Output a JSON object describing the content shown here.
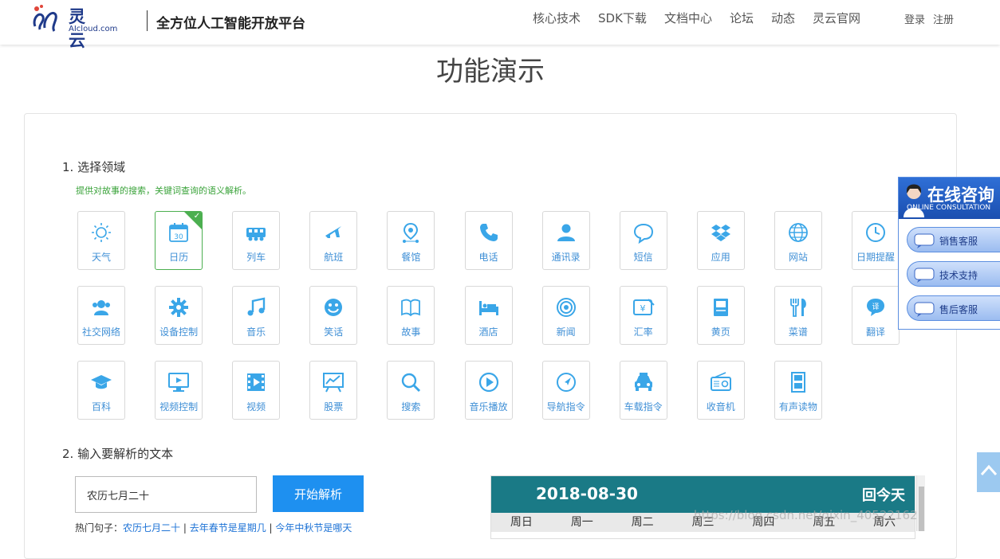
{
  "header": {
    "logo_name": "灵云",
    "logo_domain": "AIcloud.com",
    "slogan": "全方位人工智能开放平台",
    "nav": [
      "核心技术",
      "SDK下载",
      "文档中心",
      "论坛",
      "动态",
      "灵云官网"
    ],
    "login": "登录",
    "register": "注册"
  },
  "page_title": "功能演示",
  "step1": {
    "title": "1. 选择领域",
    "hint": "提供对故事的搜索，关键词查询的语义解析。"
  },
  "domains": [
    {
      "label": "天气",
      "icon": "sun-icon"
    },
    {
      "label": "日历",
      "icon": "calendar-icon",
      "selected": true
    },
    {
      "label": "列车",
      "icon": "train-icon"
    },
    {
      "label": "航班",
      "icon": "airplane-icon"
    },
    {
      "label": "餐馆",
      "icon": "map-pin-icon"
    },
    {
      "label": "电话",
      "icon": "phone-icon"
    },
    {
      "label": "通讯录",
      "icon": "contact-icon"
    },
    {
      "label": "短信",
      "icon": "message-icon"
    },
    {
      "label": "应用",
      "icon": "app-box-icon"
    },
    {
      "label": "网站",
      "icon": "globe-icon"
    },
    {
      "label": "日期提醒",
      "icon": "clock-icon"
    },
    {
      "label": "社交网络",
      "icon": "users-icon"
    },
    {
      "label": "设备控制",
      "icon": "gear-icon"
    },
    {
      "label": "音乐",
      "icon": "music-icon"
    },
    {
      "label": "笑话",
      "icon": "smile-icon"
    },
    {
      "label": "故事",
      "icon": "book-icon"
    },
    {
      "label": "酒店",
      "icon": "bed-icon"
    },
    {
      "label": "新闻",
      "icon": "target-icon"
    },
    {
      "label": "汇率",
      "icon": "currency-icon"
    },
    {
      "label": "黄页",
      "icon": "yellow-pages-icon"
    },
    {
      "label": "菜谱",
      "icon": "utensils-icon"
    },
    {
      "label": "翻译",
      "icon": "translate-icon"
    },
    {
      "label": "百科",
      "icon": "graduation-cap-icon"
    },
    {
      "label": "视频控制",
      "icon": "monitor-play-icon"
    },
    {
      "label": "视频",
      "icon": "film-icon"
    },
    {
      "label": "股票",
      "icon": "chart-board-icon"
    },
    {
      "label": "搜索",
      "icon": "search-icon"
    },
    {
      "label": "音乐播放",
      "icon": "play-circle-icon"
    },
    {
      "label": "导航指令",
      "icon": "navigation-icon"
    },
    {
      "label": "车载指令",
      "icon": "car-icon"
    },
    {
      "label": "收音机",
      "icon": "radio-icon"
    },
    {
      "label": "有声读物",
      "icon": "film-strip-icon"
    }
  ],
  "step2": {
    "title": "2. 输入要解析的文本",
    "input_value": "农历七月二十",
    "parse_button": "开始解析",
    "hot_label": "热门句子：",
    "hot_items": [
      "农历七月二十",
      "去年春节是星期几",
      "今年中秋节是哪天"
    ]
  },
  "calendar": {
    "date": "2018-08-30",
    "today_button": "回今天",
    "weekdays": [
      "周日",
      "周一",
      "周二",
      "周三",
      "周四",
      "周五",
      "周六"
    ]
  },
  "consult": {
    "title": "在线咨询",
    "subtitle": "ONLINE CONSULTATION",
    "buttons": [
      "销售客服",
      "技术支持",
      "售后客服"
    ]
  },
  "watermark": "https://blog.csdn.net/qixin_40522162",
  "colors": {
    "accent": "#1e90f0",
    "icon_blue": "#3aa6e8",
    "selected_green": "#4caf50",
    "calendar_teal": "#1a7a86"
  }
}
